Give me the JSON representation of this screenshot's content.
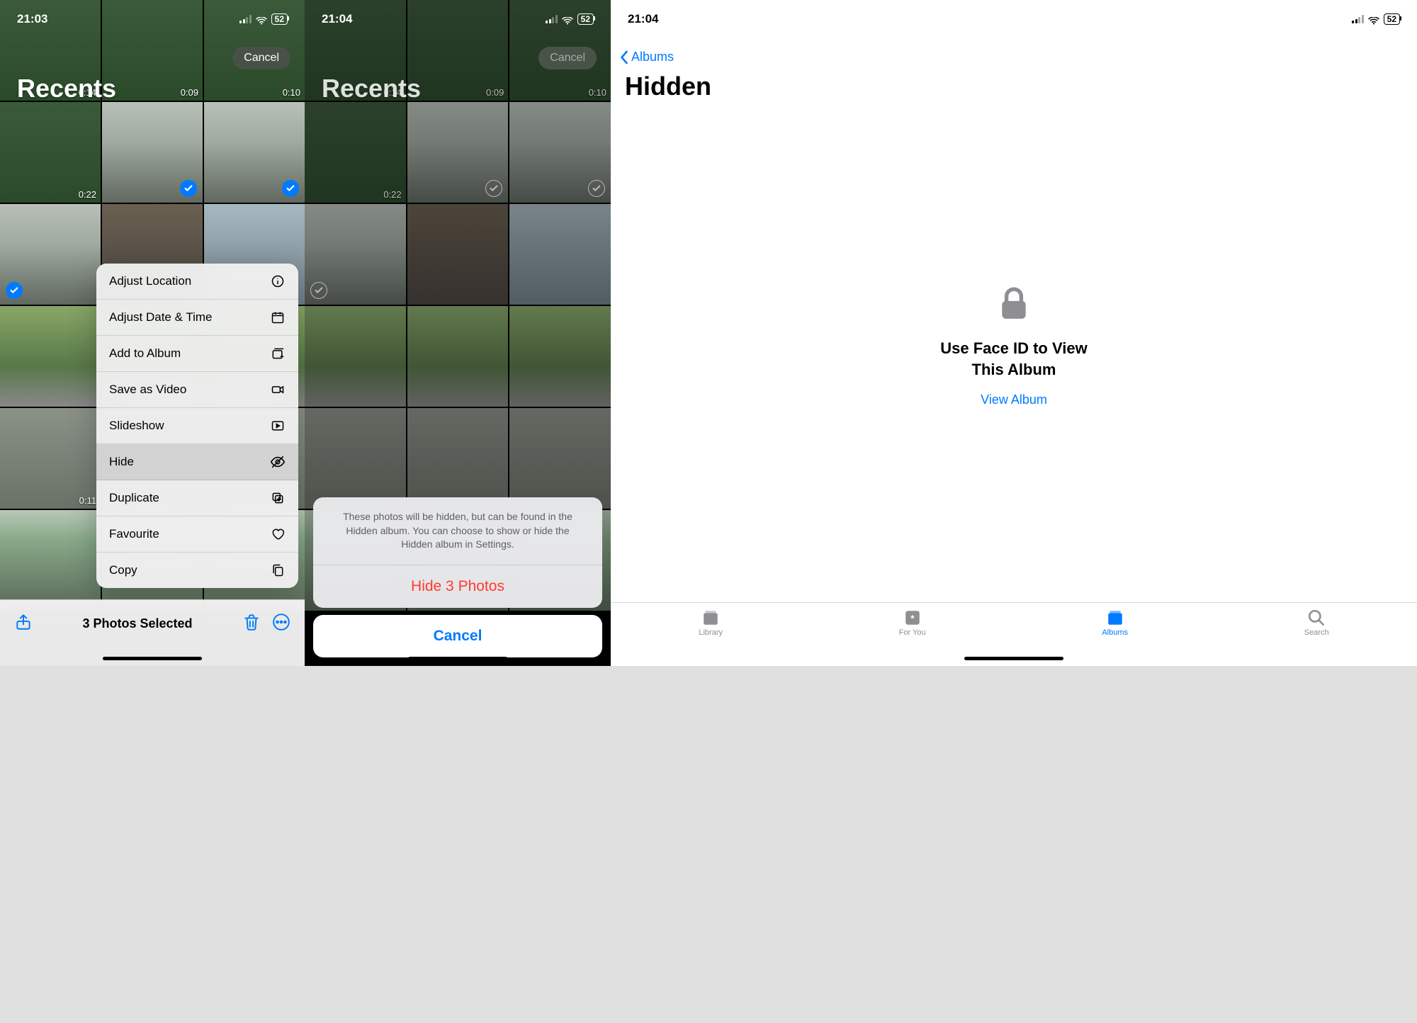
{
  "phone1": {
    "time": "21:03",
    "battery": "52",
    "album_title": "Recents",
    "cancel": "Cancel",
    "durations": [
      "0:14",
      "0:09",
      "0:10",
      "0:22",
      "0:11"
    ],
    "menu": {
      "adjust_location": "Adjust Location",
      "adjust_date": "Adjust Date & Time",
      "add_to_album": "Add to Album",
      "save_as_video": "Save as Video",
      "slideshow": "Slideshow",
      "hide": "Hide",
      "duplicate": "Duplicate",
      "favourite": "Favourite",
      "copy": "Copy"
    },
    "selected_count": "3 Photos Selected"
  },
  "phone2": {
    "time": "21:04",
    "battery": "52",
    "album_title": "Recents",
    "cancel_top": "Cancel",
    "durations": [
      "0:14",
      "0:09",
      "0:10",
      "0:22"
    ],
    "sheet_msg": "These photos will be hidden, but can be found in the Hidden album. You can choose to show or hide the Hidden album in Settings.",
    "hide_action": "Hide 3 Photos",
    "cancel": "Cancel"
  },
  "phone3": {
    "time": "21:04",
    "battery": "52",
    "back": "Albums",
    "title": "Hidden",
    "faceid_line1": "Use Face ID to View",
    "faceid_line2": "This Album",
    "view_album": "View Album",
    "tabs": {
      "library": "Library",
      "for_you": "For You",
      "albums": "Albums",
      "search": "Search"
    }
  }
}
